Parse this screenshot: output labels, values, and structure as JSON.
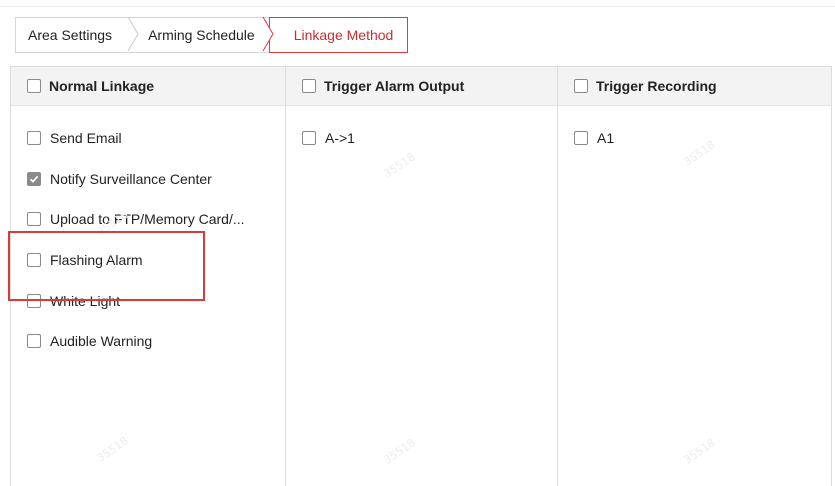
{
  "tabs": [
    {
      "label": "Area Settings",
      "active": false
    },
    {
      "label": "Arming Schedule",
      "active": false
    },
    {
      "label": "Linkage Method",
      "active": true
    }
  ],
  "columns": {
    "normal": {
      "header": "Normal Linkage",
      "header_checked": false,
      "items": [
        {
          "label": "Send Email",
          "checked": false
        },
        {
          "label": "Notify Surveillance Center",
          "checked": true
        },
        {
          "label": "Upload to FTP/Memory Card/...",
          "checked": false
        },
        {
          "label": "Flashing Alarm",
          "checked": false
        },
        {
          "label": "White Light",
          "checked": false
        },
        {
          "label": "Audible Warning",
          "checked": false
        }
      ]
    },
    "alarm_output": {
      "header": "Trigger Alarm Output",
      "header_checked": false,
      "items": [
        {
          "label": "A->1",
          "checked": false
        }
      ]
    },
    "recording": {
      "header": "Trigger Recording",
      "header_checked": false,
      "items": [
        {
          "label": "A1",
          "checked": false
        }
      ]
    }
  },
  "watermark": "35518",
  "colors": {
    "accent_red": "#d93a3a",
    "border": "#dcdcdc",
    "header_bg": "#f3f3f3",
    "checkbox_gray": "#8a8a8a"
  }
}
